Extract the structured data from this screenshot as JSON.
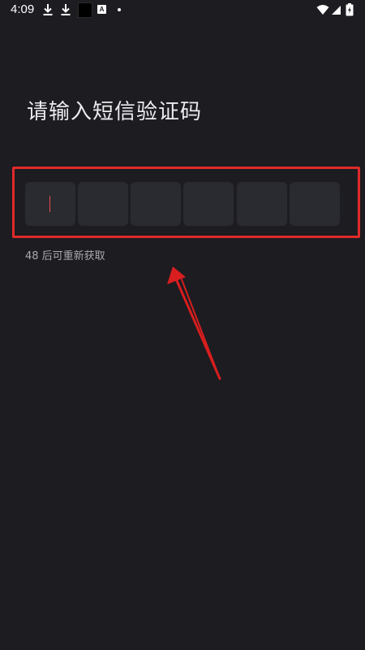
{
  "status_bar": {
    "time": "4:09",
    "icons": [
      "download-icon",
      "download-icon",
      "black-square-icon",
      "a-notification-icon",
      "dot-icon",
      "wifi-icon",
      "signal-icon",
      "battery-charging-icon"
    ],
    "a_icon_label": "A"
  },
  "screen": {
    "title": "请输入短信验证码",
    "code_length": 6,
    "code_values": [
      "",
      "",
      "",
      "",
      "",
      ""
    ],
    "countdown_text": "48 后可重新获取"
  },
  "colors": {
    "background": "#1c1c21",
    "cell": "#2a2b30",
    "highlight": "#e02a2a",
    "cursor": "#e84b4b",
    "title_text": "#ececee",
    "secondary_text": "#a9a9ae"
  },
  "annotation": {
    "highlight_box": "red-rectangle",
    "arrow": "red-arrow-pointing-up"
  }
}
